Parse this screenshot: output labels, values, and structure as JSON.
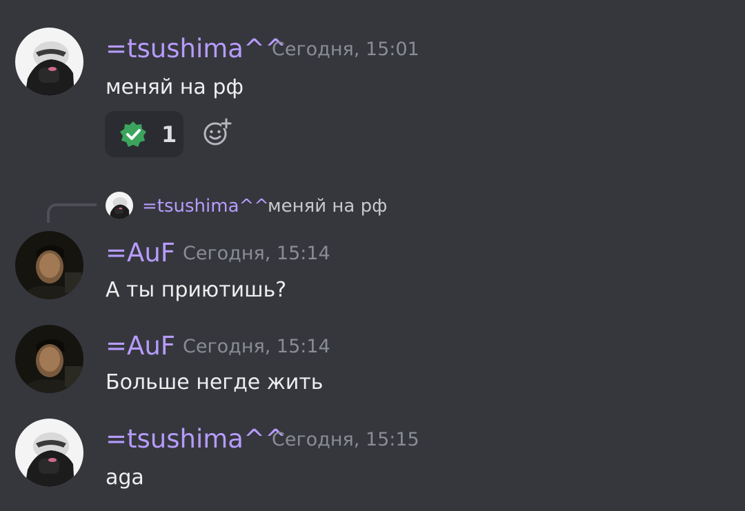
{
  "colors": {
    "background": "#36373d",
    "username": "#b79cff",
    "timestamp": "#8a8d96",
    "message_text": "#eeeeef",
    "reply_text": "#c8c9cd",
    "reaction_bg": "#2b2c31",
    "check_badge": "#3ba55d"
  },
  "messages": [
    {
      "author": "=tsushima^^",
      "timestamp": "Сегодня, 15:01",
      "text": "меняй на рф",
      "avatar_icon": "white-masked-person-avatar",
      "reaction": {
        "icon": "verified-check-icon",
        "count": "1"
      }
    },
    {
      "reply_to": {
        "author": "=tsushima^^",
        "text": "меняй на рф"
      },
      "author": "=AuF",
      "timestamp": "Сегодня, 15:14",
      "text": "А ты приютишь?",
      "avatar_icon": "dark-selfie-avatar"
    },
    {
      "author": "=AuF",
      "timestamp": "Сегодня, 15:14",
      "text": "Больше негде жить",
      "avatar_icon": "dark-selfie-avatar"
    },
    {
      "author": "=tsushima^^",
      "timestamp": "Сегодня, 15:15",
      "text": "aga",
      "avatar_icon": "white-masked-person-avatar"
    }
  ]
}
